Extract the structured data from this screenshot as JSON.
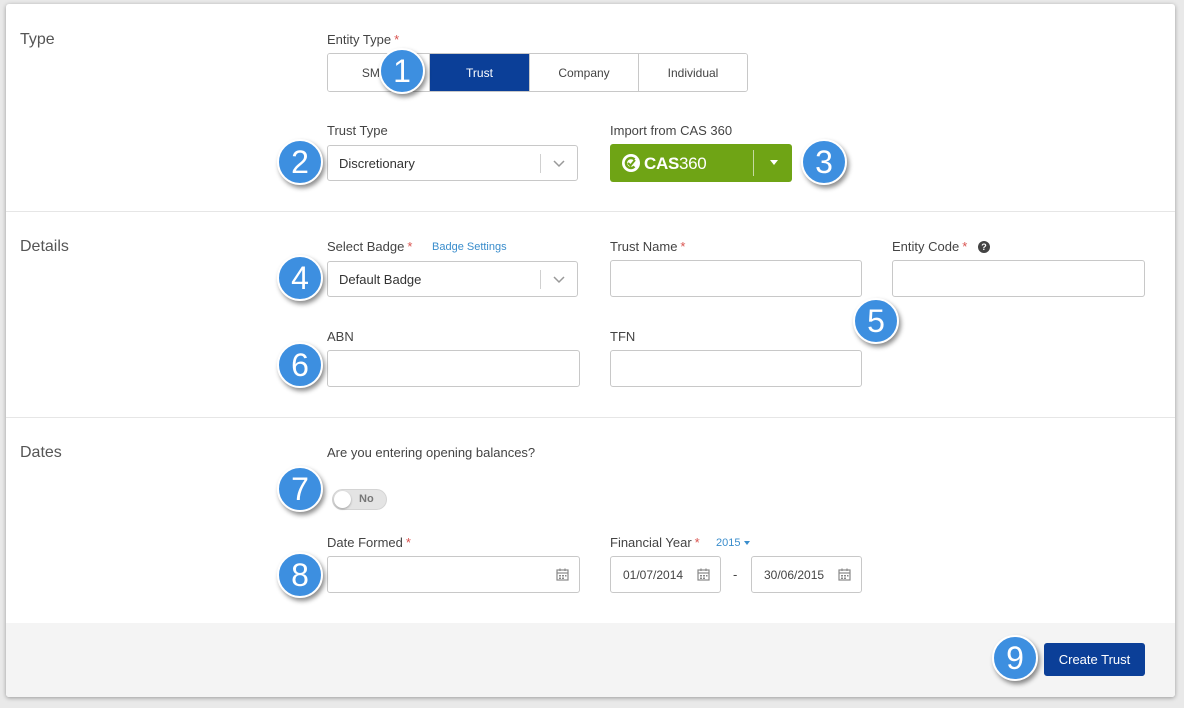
{
  "sections": {
    "type_title": "Type",
    "details_title": "Details",
    "dates_title": "Dates"
  },
  "entity_type": {
    "label": "Entity Type",
    "required_mark": "*",
    "options": [
      "SMSF",
      "Trust",
      "Company",
      "Individual"
    ],
    "selected": "Trust"
  },
  "trust_type": {
    "label": "Trust Type",
    "value": "Discretionary"
  },
  "import": {
    "label": "Import from CAS 360",
    "brand_bold": "CAS",
    "brand_thin": "360"
  },
  "badge": {
    "label": "Select Badge",
    "required_mark": "*",
    "settings_link": "Badge Settings",
    "value": "Default Badge"
  },
  "trust_name": {
    "label": "Trust Name",
    "required_mark": "*",
    "value": ""
  },
  "entity_code": {
    "label": "Entity Code",
    "required_mark": "*",
    "help": "?",
    "value": ""
  },
  "abn": {
    "label": "ABN",
    "value": ""
  },
  "tfn": {
    "label": "TFN",
    "value": ""
  },
  "opening_balances": {
    "question": "Are you entering opening balances?",
    "toggle_label": "No",
    "on": false
  },
  "date_formed": {
    "label": "Date Formed",
    "required_mark": "*",
    "value": ""
  },
  "financial_year": {
    "label": "Financial Year",
    "required_mark": "*",
    "year": "2015",
    "start": "01/07/2014",
    "separator": "-",
    "end": "30/06/2015"
  },
  "footer": {
    "create_label": "Create Trust"
  },
  "markers": [
    "1",
    "2",
    "3",
    "4",
    "5",
    "6",
    "7",
    "8",
    "9"
  ],
  "icons": {
    "dropdown": "chevron-down-icon",
    "calendar": "calendar-icon",
    "help": "question-circle-icon",
    "cas_logo": "cas360-logo-icon"
  },
  "colors": {
    "primary": "#0b3f98",
    "cas_green": "#6fa415",
    "marker": "#3d8fe0",
    "required": "#d9534f",
    "link": "#3a8dcc"
  }
}
